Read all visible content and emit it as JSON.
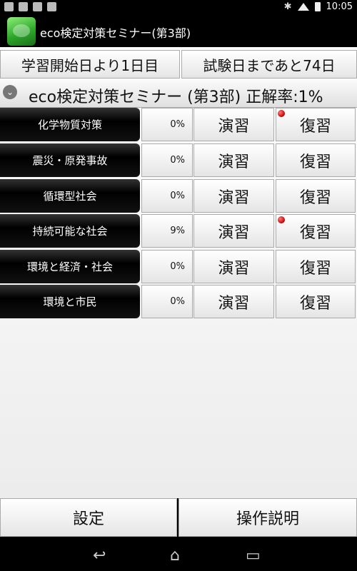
{
  "status": {
    "time": "10:05",
    "bluetooth": "✱"
  },
  "app": {
    "title": "eco検定対策セミナー(第3部)"
  },
  "top": {
    "start_day": "学習開始日より1日目",
    "exam_countdown": "試験日まであと74日"
  },
  "section": {
    "title": "eco検定対策セミナー (第3部) 正解率:1%"
  },
  "rows": [
    {
      "name": "化学物質対策",
      "percent": "0%",
      "practice": "演習",
      "review": "復習",
      "has_review_badge": true
    },
    {
      "name": "震災・原発事故",
      "percent": "0%",
      "practice": "演習",
      "review": "復習",
      "has_review_badge": false
    },
    {
      "name": "循環型社会",
      "percent": "0%",
      "practice": "演習",
      "review": "復習",
      "has_review_badge": false
    },
    {
      "name": "持続可能な社会",
      "percent": "9%",
      "practice": "演習",
      "review": "復習",
      "has_review_badge": true
    },
    {
      "name": "環境と経済・社会",
      "percent": "0%",
      "practice": "演習",
      "review": "復習",
      "has_review_badge": false
    },
    {
      "name": "環境と市民",
      "percent": "0%",
      "practice": "演習",
      "review": "復習",
      "has_review_badge": false
    }
  ],
  "bottom": {
    "settings": "設定",
    "instructions": "操作説明"
  },
  "nav": {
    "back": "↩",
    "home": "⌂",
    "recents": "▭"
  },
  "colors": {
    "badge": "#c00000",
    "app_icon_green": "#2da82b"
  }
}
